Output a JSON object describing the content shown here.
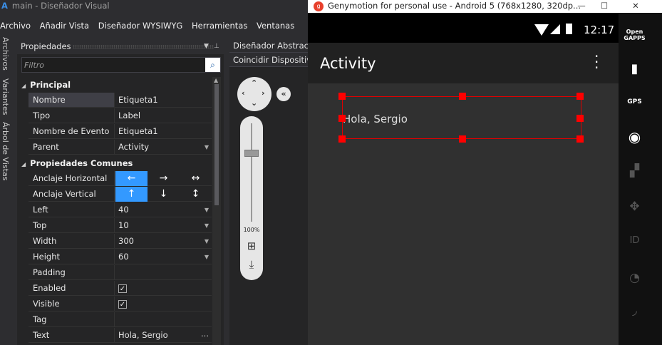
{
  "window": {
    "title": "main - Diseñador Visual",
    "app_icon": "A"
  },
  "menu": [
    "Archivo",
    "Añadir Vista",
    "Diseñador WYSIWYG",
    "Herramientas",
    "Ventanas"
  ],
  "side_tabs": [
    "Archivos",
    "Variantes",
    "Árbol de Vistas"
  ],
  "properties_panel": {
    "title": "Propiedades",
    "pin_icon": "pin-icon",
    "filter_placeholder": "Filtro",
    "categories": [
      {
        "name": "Principal",
        "rows": [
          {
            "name": "Nombre",
            "value": "Etiqueta1"
          },
          {
            "name": "Tipo",
            "value": "Label"
          },
          {
            "name": "Nombre de Evento",
            "value": "Etiqueta1"
          },
          {
            "name": "Parent",
            "value": "Activity"
          }
        ]
      },
      {
        "name": "Propiedades Comunes",
        "rows": [
          {
            "name": "Anclaje Horizontal"
          },
          {
            "name": "Anclaje Vertical"
          },
          {
            "name": "Left",
            "value": "40"
          },
          {
            "name": "Top",
            "value": "10"
          },
          {
            "name": "Width",
            "value": "300"
          },
          {
            "name": "Height",
            "value": "60"
          },
          {
            "name": "Padding",
            "value": ""
          },
          {
            "name": "Enabled",
            "value": "✓"
          },
          {
            "name": "Visible",
            "value": "✓"
          },
          {
            "name": "Tag",
            "value": ""
          },
          {
            "name": "Text",
            "value": "Hola, Sergio"
          }
        ]
      }
    ],
    "anchor_horizontal": [
      "←",
      "→",
      "↔"
    ],
    "anchor_vertical": [
      "↑",
      "↓",
      "↕"
    ],
    "selected_row": "Nombre",
    "ellipsis": "..."
  },
  "designer_panel": {
    "tabs": [
      "Diseñador Abstracto",
      "Coincidir Dispositivo"
    ],
    "zoom_label": "100%",
    "zoom_level": 100
  },
  "emulator": {
    "window_title": "Genymotion for personal use - Android 5 (768x1280, 320dp...",
    "logo": "genymotion-logo-icon",
    "clock": "12:17",
    "action_bar_title": "Activity",
    "label_text": "Hola, Sergio",
    "sidebar": [
      "Open GAPPS",
      "GPS"
    ],
    "accent": "#ff0000"
  }
}
